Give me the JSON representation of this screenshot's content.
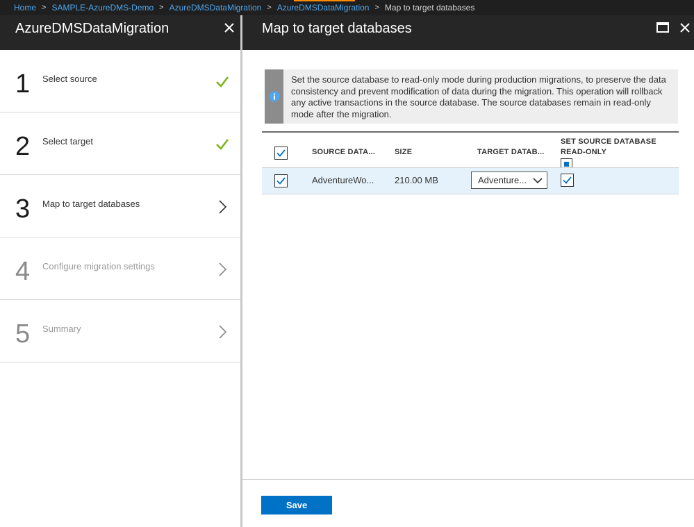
{
  "breadcrumb": {
    "items": [
      "Home",
      "SAMPLE-AzureDMS-Demo",
      "AzureDMSDataMigration",
      "AzureDMSDataMigration"
    ],
    "current": "Map to target databases"
  },
  "left_blade": {
    "title": "AzureDMSDataMigration",
    "steps": [
      {
        "number": "1",
        "label": "Select source",
        "status": "complete"
      },
      {
        "number": "2",
        "label": "Select target",
        "status": "complete"
      },
      {
        "number": "3",
        "label": "Map to target databases",
        "status": "current"
      },
      {
        "number": "4",
        "label": "Configure migration settings",
        "status": "disabled"
      },
      {
        "number": "5",
        "label": "Summary",
        "status": "disabled"
      }
    ]
  },
  "right_blade": {
    "title": "Map to target databases",
    "info_text": "Set the source database to read-only mode during production migrations, to preserve the data consistency and prevent modification of data during the migration. This operation will rollback any active transactions in the source database. The source databases remain in read-only mode after the migration.",
    "table": {
      "headers": {
        "source": "SOURCE DATA...",
        "size": "SIZE",
        "target": "TARGET DATAB...",
        "readonly_line1": "SET SOURCE DATABASE",
        "readonly_line2": "READ-ONLY"
      },
      "rows": [
        {
          "source": "AdventureWo...",
          "size": "210.00 MB",
          "target": "Adventure...",
          "selected": true,
          "readonly": true
        }
      ]
    },
    "save_label": "Save"
  },
  "colors": {
    "accent": "#0072c6",
    "check_green": "#7ab51d",
    "header_bg": "#262626",
    "link": "#4ea6ec"
  }
}
